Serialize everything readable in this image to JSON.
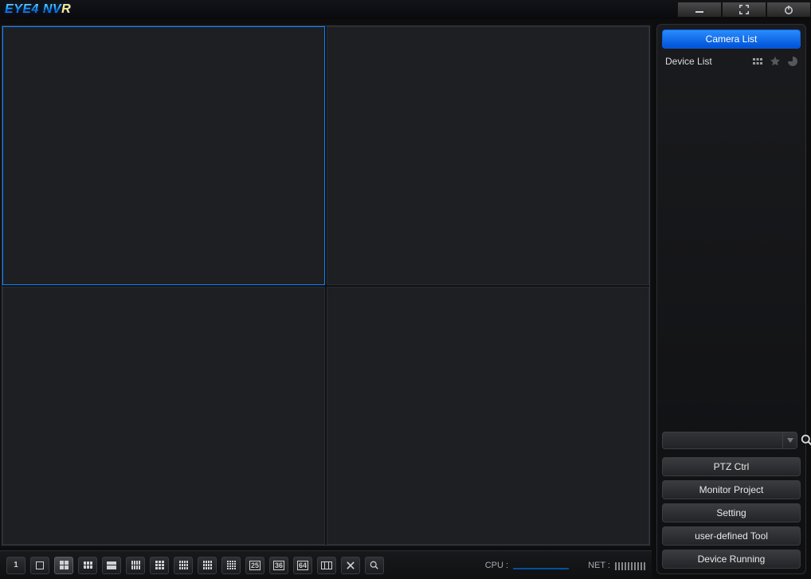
{
  "app": {
    "title": "EYE4 NVR"
  },
  "sidebar": {
    "camera_list": "Camera List",
    "device_list": "Device List",
    "search_value": "",
    "ptz": "PTZ Ctrl",
    "monitor": "Monitor Project",
    "setting": "Setting",
    "tool": "user-defined Tool",
    "running": "Device Running"
  },
  "bottom": {
    "label_1": "1",
    "label_25": "25",
    "label_36": "36",
    "label_64": "64",
    "cpu_label": "CPU :",
    "net_label": "NET :"
  },
  "video": {
    "cells": 4,
    "selected_index": 0
  }
}
